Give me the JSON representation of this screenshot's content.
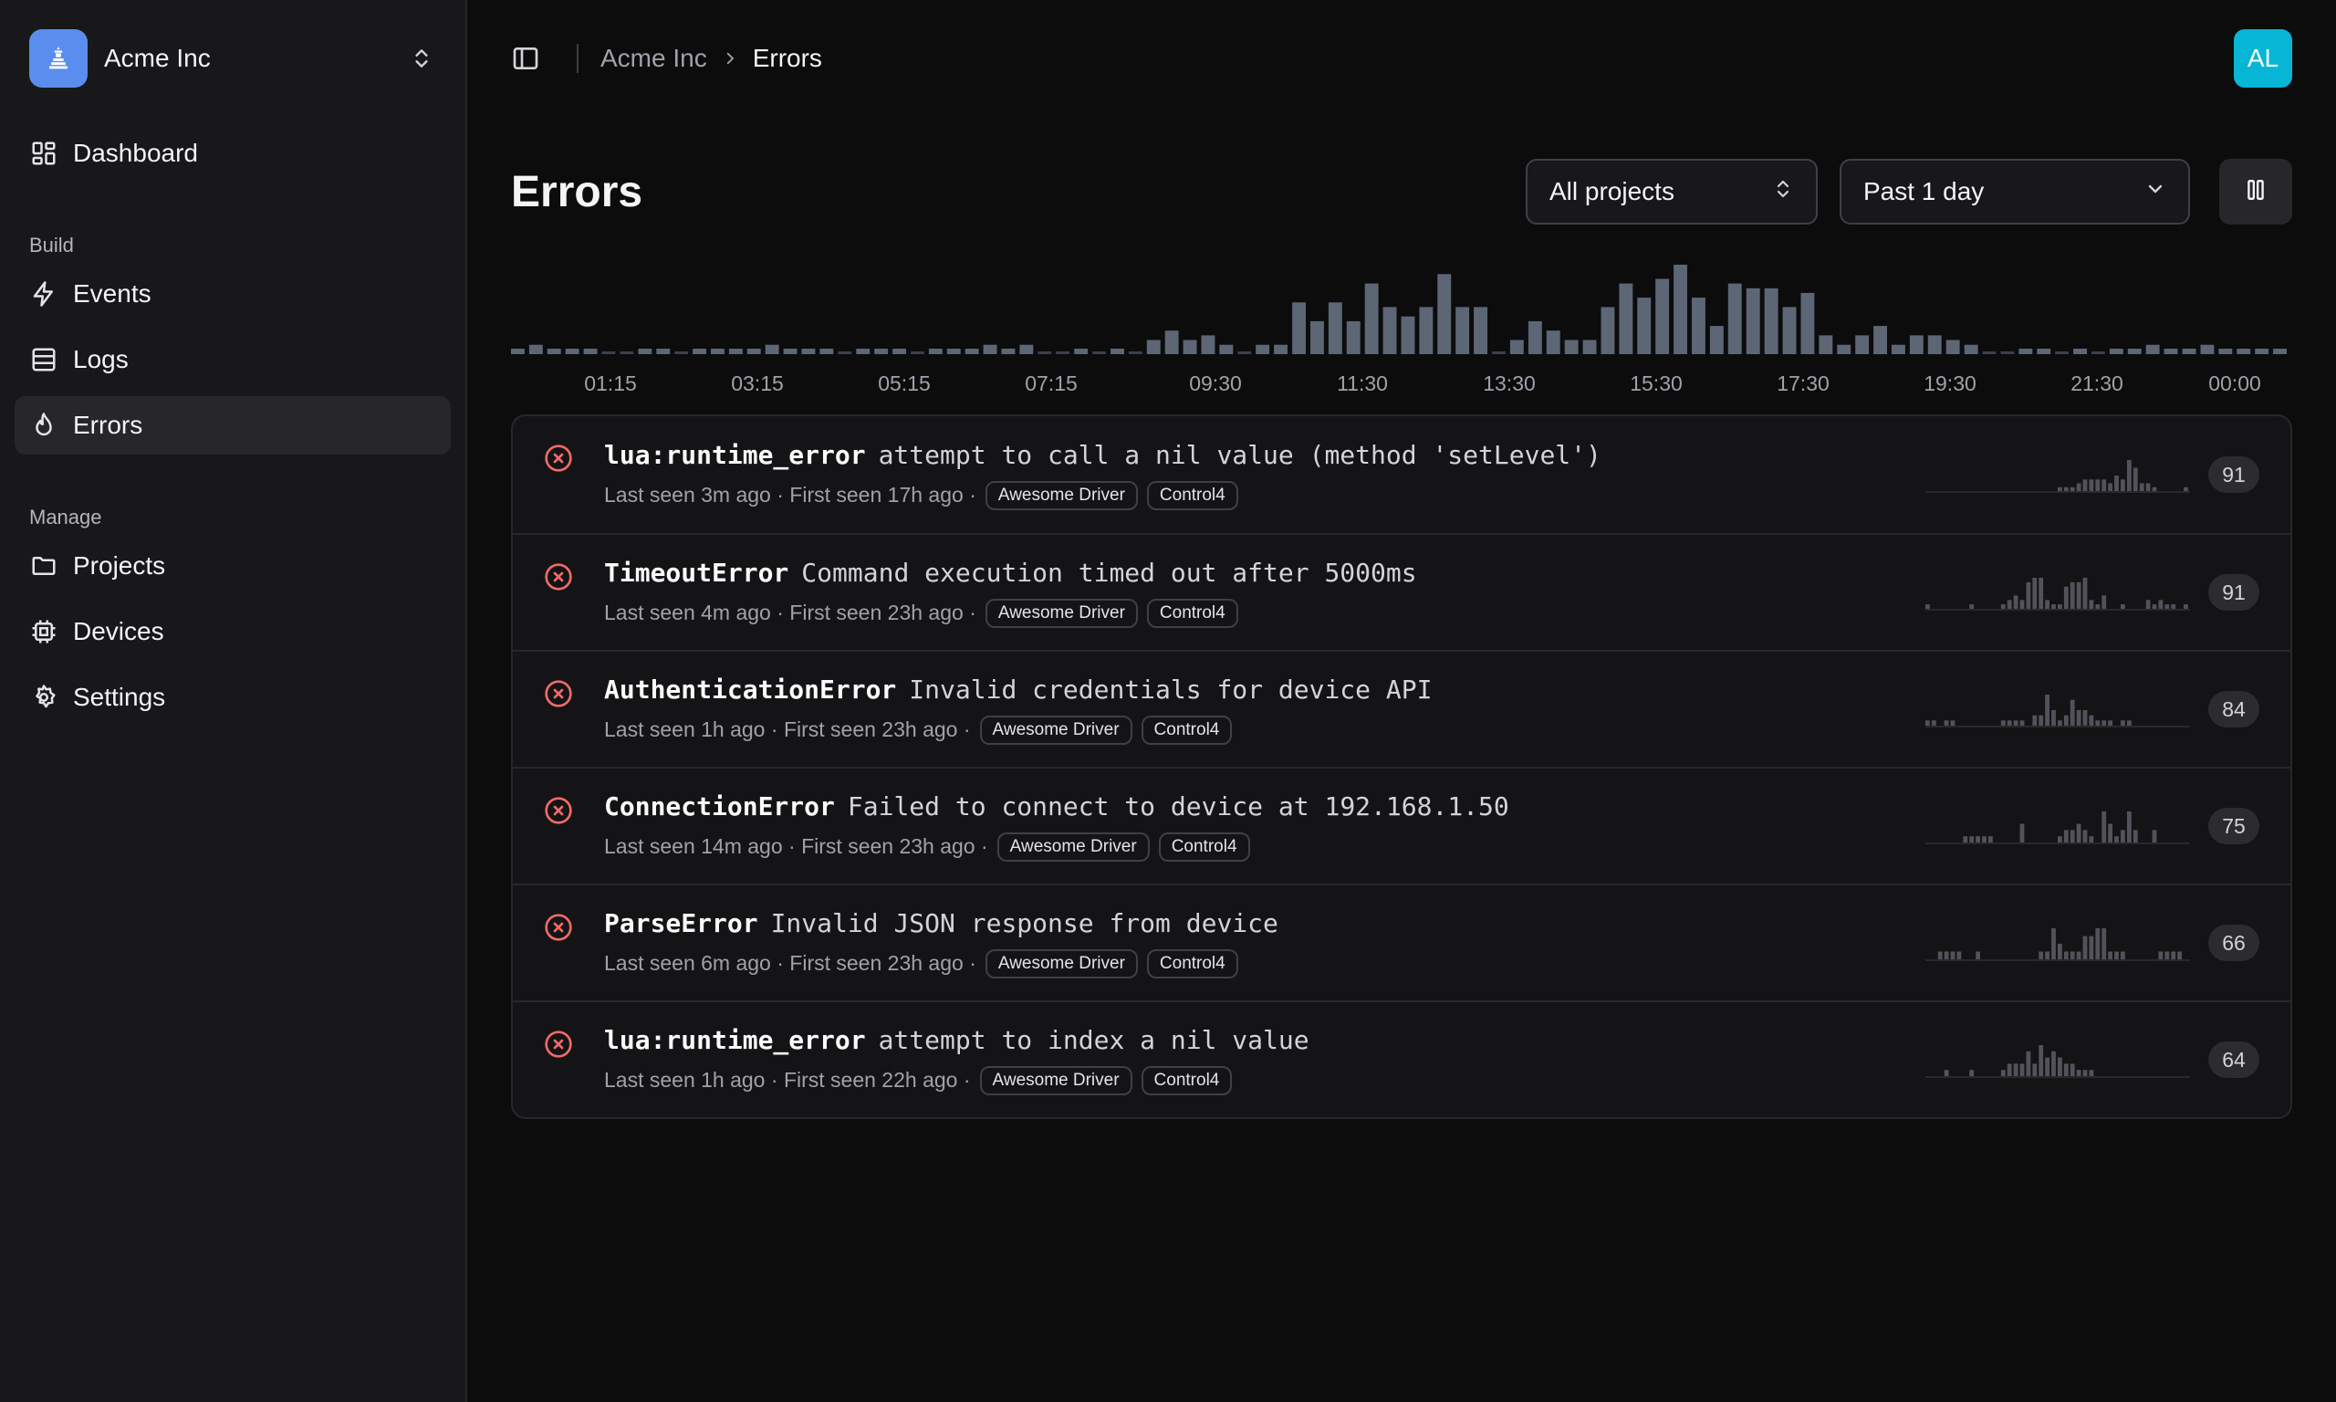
{
  "org": {
    "name": "Acme Inc",
    "logo_color": "#5b8def"
  },
  "sidebar": {
    "top_items": [
      {
        "label": "Dashboard",
        "icon": "dashboard-icon"
      }
    ],
    "sections": [
      {
        "title": "Build",
        "items": [
          {
            "label": "Events",
            "icon": "bolt-icon"
          },
          {
            "label": "Logs",
            "icon": "logs-icon"
          },
          {
            "label": "Errors",
            "icon": "flame-icon",
            "active": true
          }
        ]
      },
      {
        "title": "Manage",
        "items": [
          {
            "label": "Projects",
            "icon": "folder-icon"
          },
          {
            "label": "Devices",
            "icon": "chip-icon"
          },
          {
            "label": "Settings",
            "icon": "gear-icon"
          }
        ]
      }
    ]
  },
  "breadcrumb": {
    "root": "Acme Inc",
    "current": "Errors"
  },
  "user": {
    "initials": "AL",
    "avatar_color": "#06b6d4"
  },
  "page": {
    "title": "Errors"
  },
  "filters": {
    "projects": "All projects",
    "range": "Past 1 day"
  },
  "chart_data": {
    "type": "bar",
    "x_tick_labels": [
      "01:15",
      "03:15",
      "05:15",
      "07:15",
      "09:30",
      "11:30",
      "13:30",
      "15:30",
      "17:30",
      "19:30",
      "21:30",
      "00:00"
    ],
    "values": [
      1,
      2,
      1,
      1,
      1,
      0,
      0,
      1,
      1,
      0,
      1,
      1,
      1,
      1,
      2,
      1,
      1,
      1,
      0,
      1,
      1,
      1,
      0,
      1,
      1,
      1,
      2,
      1,
      2,
      0,
      0,
      1,
      0,
      1,
      0,
      3,
      5,
      3,
      4,
      2,
      0,
      2,
      2,
      11,
      7,
      11,
      7,
      15,
      10,
      8,
      10,
      17,
      10,
      10,
      0,
      3,
      7,
      5,
      3,
      3,
      10,
      15,
      12,
      16,
      19,
      12,
      6,
      15,
      14,
      14,
      10,
      13,
      4,
      2,
      4,
      6,
      2,
      4,
      4,
      3,
      2,
      0,
      0,
      1,
      1,
      0,
      1,
      0,
      1,
      1,
      2,
      1,
      1,
      2,
      1,
      1,
      1,
      1
    ],
    "ymax": 19,
    "color": "#5d6675"
  },
  "errors": [
    {
      "name": "lua:runtime_error",
      "message": "attempt to call a nil value (method 'setLevel')",
      "last_seen": "Last seen 3m ago",
      "first_seen": "First seen 17h ago",
      "tags": [
        "Awesome Driver",
        "Control4"
      ],
      "count": "91",
      "spark": [
        0,
        0,
        0,
        0,
        0,
        0,
        0,
        0,
        0,
        0,
        0,
        0,
        0,
        0,
        0,
        0,
        0,
        0,
        0,
        0,
        0,
        1,
        1,
        1,
        2,
        3,
        3,
        3,
        3,
        2,
        4,
        3,
        8,
        6,
        2,
        2,
        1,
        0,
        0,
        0,
        0,
        1
      ]
    },
    {
      "name": "TimeoutError",
      "message": "Command execution timed out after 5000ms",
      "last_seen": "Last seen 4m ago",
      "first_seen": "First seen 23h ago",
      "tags": [
        "Awesome Driver",
        "Control4"
      ],
      "count": "91",
      "spark": [
        1,
        0,
        0,
        0,
        0,
        0,
        0,
        1,
        0,
        0,
        0,
        0,
        1,
        2,
        3,
        2,
        6,
        7,
        7,
        2,
        1,
        1,
        5,
        6,
        6,
        7,
        2,
        1,
        3,
        0,
        0,
        1,
        0,
        0,
        0,
        2,
        1,
        2,
        1,
        1,
        0,
        1
      ]
    },
    {
      "name": "AuthenticationError",
      "message": "Invalid credentials for device API",
      "last_seen": "Last seen 1h ago",
      "first_seen": "First seen 23h ago",
      "tags": [
        "Awesome Driver",
        "Control4"
      ],
      "count": "84",
      "spark": [
        1,
        1,
        0,
        1,
        1,
        0,
        0,
        0,
        0,
        0,
        0,
        0,
        1,
        1,
        1,
        1,
        0,
        2,
        2,
        6,
        3,
        1,
        2,
        5,
        3,
        3,
        2,
        1,
        1,
        1,
        0,
        1,
        1,
        0,
        0,
        0,
        0,
        0,
        0,
        0,
        0,
        0
      ]
    },
    {
      "name": "ConnectionError",
      "message": "Failed to connect to device at 192.168.1.50",
      "last_seen": "Last seen 14m ago",
      "first_seen": "First seen 23h ago",
      "tags": [
        "Awesome Driver",
        "Control4"
      ],
      "count": "75",
      "spark": [
        0,
        0,
        0,
        0,
        0,
        0,
        1,
        1,
        1,
        1,
        1,
        0,
        0,
        0,
        0,
        3,
        0,
        0,
        0,
        0,
        0,
        1,
        2,
        2,
        3,
        2,
        1,
        0,
        5,
        3,
        1,
        2,
        5,
        2,
        0,
        0,
        2,
        0,
        0,
        0,
        0,
        0
      ]
    },
    {
      "name": "ParseError",
      "message": "Invalid JSON response from device",
      "last_seen": "Last seen 6m ago",
      "first_seen": "First seen 23h ago",
      "tags": [
        "Awesome Driver",
        "Control4"
      ],
      "count": "66",
      "spark": [
        0,
        0,
        1,
        1,
        1,
        1,
        0,
        0,
        1,
        0,
        0,
        0,
        0,
        0,
        0,
        0,
        0,
        0,
        1,
        1,
        4,
        2,
        1,
        1,
        1,
        3,
        3,
        4,
        4,
        1,
        1,
        1,
        0,
        0,
        0,
        0,
        0,
        1,
        1,
        1,
        1,
        0
      ]
    },
    {
      "name": "lua:runtime_error",
      "message": "attempt to index a nil value",
      "last_seen": "Last seen 1h ago",
      "first_seen": "First seen 22h ago",
      "tags": [
        "Awesome Driver",
        "Control4"
      ],
      "count": "64",
      "spark": [
        0,
        0,
        0,
        1,
        0,
        0,
        0,
        1,
        0,
        0,
        0,
        0,
        1,
        2,
        2,
        2,
        4,
        2,
        5,
        3,
        4,
        3,
        2,
        2,
        1,
        1,
        1,
        0,
        0,
        0,
        0,
        0,
        0,
        0,
        0,
        0,
        0,
        0,
        0,
        0,
        0,
        0
      ]
    }
  ]
}
